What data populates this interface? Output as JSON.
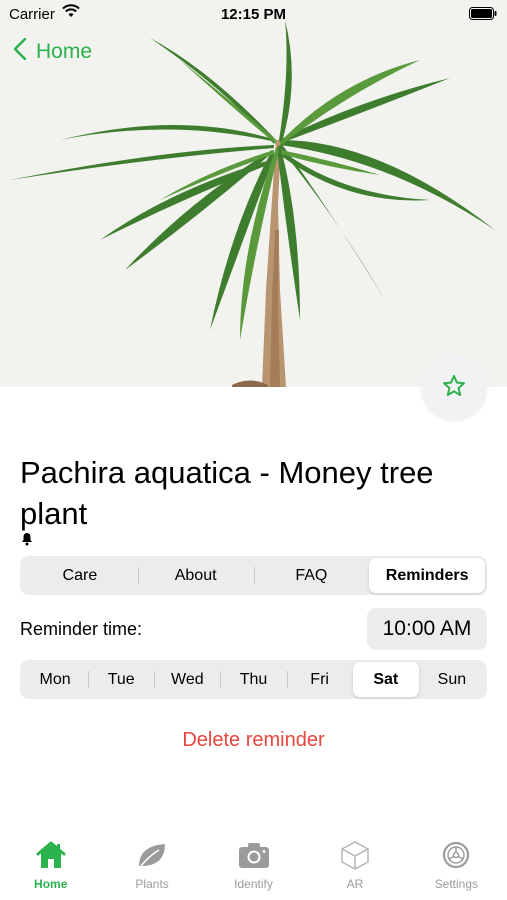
{
  "status_bar": {
    "carrier": "Carrier",
    "time": "12:15 PM"
  },
  "nav": {
    "back_label": "Home"
  },
  "plant": {
    "name": "Pachira aquatica - Money tree plant"
  },
  "segments": [
    {
      "label": "Care",
      "active": false
    },
    {
      "label": "About",
      "active": false
    },
    {
      "label": "FAQ",
      "active": false
    },
    {
      "label": "Reminders",
      "active": true
    }
  ],
  "reminder": {
    "time_label": "Reminder time:",
    "time_value": "10:00 AM",
    "days": [
      {
        "label": "Mon",
        "selected": false
      },
      {
        "label": "Tue",
        "selected": false
      },
      {
        "label": "Wed",
        "selected": false
      },
      {
        "label": "Thu",
        "selected": false
      },
      {
        "label": "Fri",
        "selected": false
      },
      {
        "label": "Sat",
        "selected": true
      },
      {
        "label": "Sun",
        "selected": false
      }
    ],
    "delete_label": "Delete reminder"
  },
  "tabs": [
    {
      "label": "Home",
      "icon": "home-icon",
      "active": true
    },
    {
      "label": "Plants",
      "icon": "leaf-icon",
      "active": false
    },
    {
      "label": "Identify",
      "icon": "camera-icon",
      "active": false
    },
    {
      "label": "AR",
      "icon": "cube-icon",
      "active": false
    },
    {
      "label": "Settings",
      "icon": "gear-icon",
      "active": false
    }
  ],
  "colors": {
    "accent": "#2bb24c",
    "destructive": "#e8463c",
    "segment_bg": "#ececee"
  }
}
